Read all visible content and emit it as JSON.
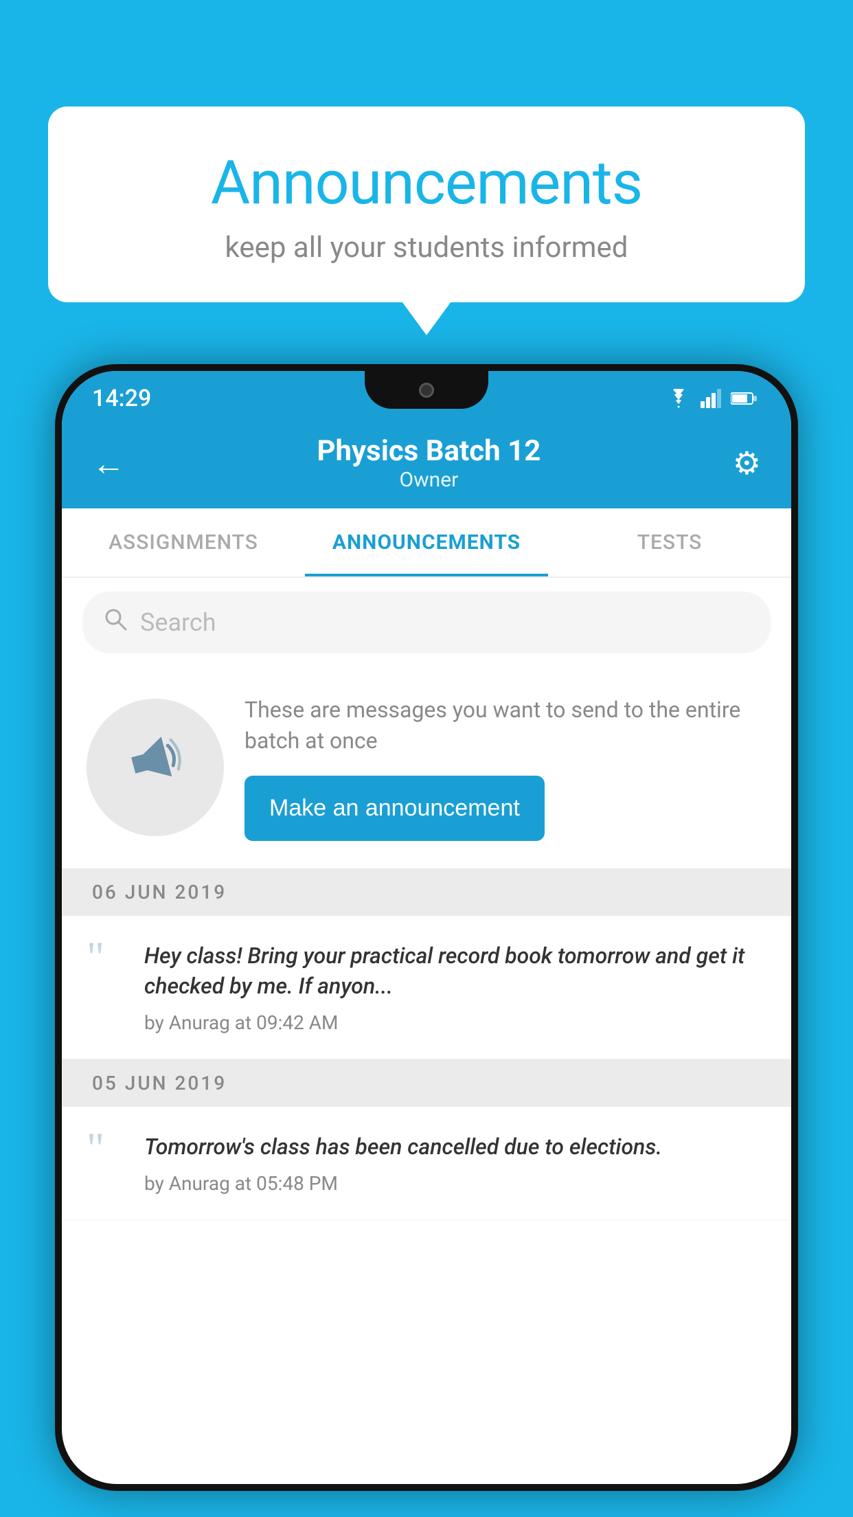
{
  "background_color": "#1ab5e8",
  "speech_bubble": {
    "title": "Announcements",
    "subtitle": "keep all your students informed"
  },
  "phone": {
    "status_bar": {
      "time": "14:29"
    },
    "header": {
      "title": "Physics Batch 12",
      "subtitle": "Owner",
      "back_label": "←",
      "gear_label": "⚙"
    },
    "tabs": [
      {
        "label": "ASSIGNMENTS",
        "active": false
      },
      {
        "label": "ANNOUNCEMENTS",
        "active": true
      },
      {
        "label": "TESTS",
        "active": false
      }
    ],
    "search": {
      "placeholder": "Search"
    },
    "empty_state": {
      "description": "These are messages you want to send to the entire batch at once",
      "button_label": "Make an announcement"
    },
    "date_groups": [
      {
        "date": "06  JUN  2019",
        "announcements": [
          {
            "text": "Hey class! Bring your practical record book tomorrow and get it checked by me. If anyon...",
            "meta": "by Anurag at 09:42 AM"
          }
        ]
      },
      {
        "date": "05  JUN  2019",
        "announcements": [
          {
            "text": "Tomorrow's class has been cancelled due to elections.",
            "meta": "by Anurag at 05:48 PM"
          }
        ]
      }
    ]
  }
}
